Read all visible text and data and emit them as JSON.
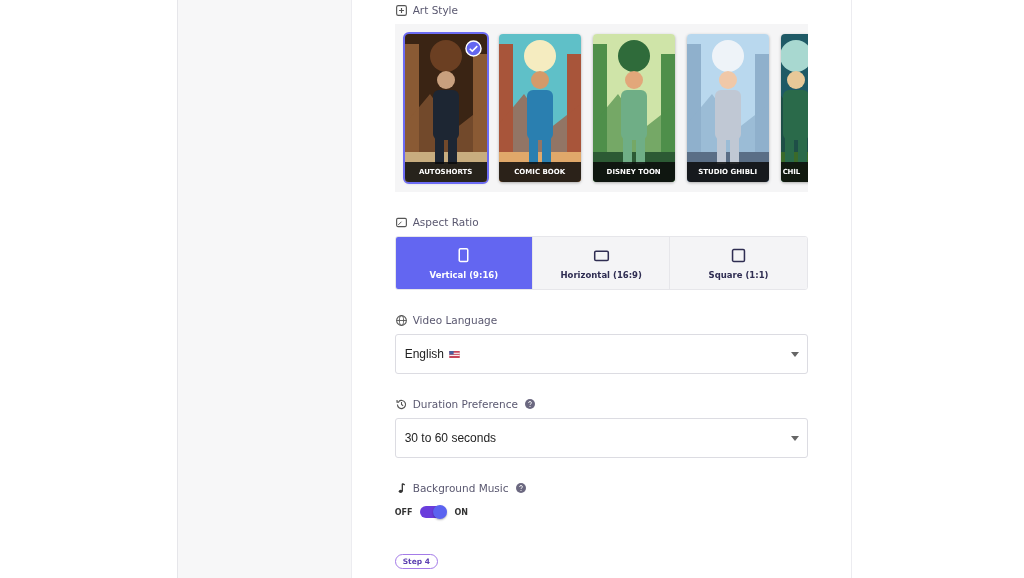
{
  "art_style": {
    "label": "Art Style",
    "styles": [
      {
        "label": "AUTOSHORTS",
        "selected": true,
        "kind": "picture"
      },
      {
        "label": "COMIC BOOK",
        "selected": false,
        "kind": "picture"
      },
      {
        "label": "DISNEY TOON",
        "selected": false,
        "kind": "picture"
      },
      {
        "label": "STUDIO GHIBLI",
        "selected": false,
        "kind": "picture"
      },
      {
        "label": "CHIL",
        "selected": false,
        "kind": "picture"
      }
    ]
  },
  "aspect_ratio": {
    "label": "Aspect Ratio",
    "options": [
      {
        "label": "Vertical (9:16)",
        "selected": true,
        "kind": "vertical"
      },
      {
        "label": "Horizontal (16:9)",
        "selected": false,
        "kind": "horizontal"
      },
      {
        "label": "Square (1:1)",
        "selected": false,
        "kind": "square"
      }
    ]
  },
  "video_language": {
    "label": "Video Language",
    "value": "English"
  },
  "duration_preference": {
    "label": "Duration Preference",
    "value": "30 to 60 seconds"
  },
  "background_music": {
    "label": "Background Music",
    "off_label": "OFF",
    "on_label": "ON",
    "on": true
  },
  "step_badge": "Step 4"
}
